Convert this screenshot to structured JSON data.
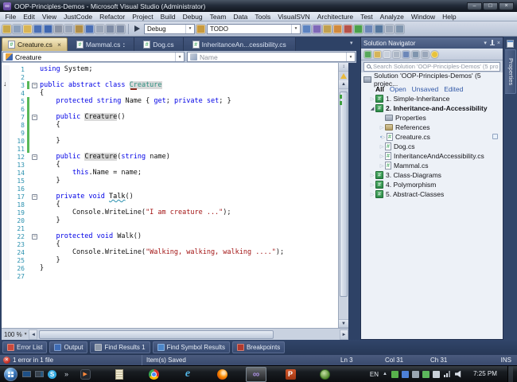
{
  "window": {
    "title": "OOP-Principles-Demos - Microsoft Visual Studio (Administrator)"
  },
  "icons": {
    "close": "×",
    "minimize": "–",
    "maximize": "□",
    "dropdown": "▾",
    "collapsed": "▷",
    "expanded": "◢",
    "fold_collapse": "−",
    "down_arrow": "↓",
    "splitter": "↕",
    "chevron_overflow": "»",
    "scroll_up": "▲",
    "scroll_down": "▼",
    "scroll_left": "◄",
    "scroll_right": "►",
    "infinity": "∞",
    "play": "▶",
    "hash": "#",
    "smiley": "☺"
  },
  "menu": {
    "items": [
      "File",
      "Edit",
      "View",
      "JustCode",
      "Refactor",
      "Project",
      "Build",
      "Debug",
      "Team",
      "Data",
      "Tools",
      "VisualSVN",
      "Architecture",
      "Test",
      "Analyze",
      "Window",
      "Help"
    ]
  },
  "toolbar": {
    "left_icons": [
      {
        "name": "new-project-icon",
        "c": "#C8A84B"
      },
      {
        "name": "add-item-icon",
        "c": "#8CA0BC"
      },
      {
        "name": "open-file-icon",
        "c": "#D9B556"
      },
      {
        "name": "save-icon",
        "c": "#4A6FB5"
      },
      {
        "name": "save-all-icon",
        "c": "#3E66B0"
      },
      {
        "name": "cut-icon",
        "c": "#8A93A5"
      },
      {
        "name": "copy-icon",
        "c": "#9AA5B8"
      },
      {
        "name": "paste-icon",
        "c": "#B08E4A"
      },
      {
        "name": "undo-icon",
        "c": "#4A6FB5"
      },
      {
        "name": "redo-icon",
        "c": "#9AA5B8"
      },
      {
        "name": "navigate-backward-icon",
        "c": "#7E8CA6"
      },
      {
        "name": "navigate-forward-icon",
        "c": "#7E8CA6"
      }
    ],
    "config_combo": {
      "value": "Debug"
    },
    "mid_icon": {
      "name": "todo-comment-icon",
      "c": "#C89A3E"
    },
    "todo_combo": {
      "value": "TODO"
    },
    "right_icons": [
      {
        "name": "solution-explorer-icon",
        "c": "#5B82C0"
      },
      {
        "name": "team-explorer-icon",
        "c": "#7E68B8"
      },
      {
        "name": "server-explorer-icon",
        "c": "#C0A050"
      },
      {
        "name": "toolbox-icon",
        "c": "#D08A3E"
      },
      {
        "name": "extensions-icon",
        "c": "#B5524A"
      },
      {
        "name": "run-tests-icon",
        "c": "#4BA04B"
      },
      {
        "name": "class-view-icon",
        "c": "#6C87B8"
      },
      {
        "name": "bookmark-icon",
        "c": "#55779F"
      },
      {
        "name": "format-icon",
        "c": "#9AA7BA"
      },
      {
        "name": "options-icon",
        "c": "#8095AE"
      }
    ]
  },
  "document_tabs": [
    {
      "label": "Creature.cs",
      "active": true,
      "closable": true
    },
    {
      "label": "Mammal.cs",
      "active": false,
      "modified": true
    },
    {
      "label": "Dog.cs",
      "active": false
    },
    {
      "label": "InheritanceAn...cessibility.cs",
      "active": false
    }
  ],
  "navigation_bar": {
    "type_dropdown": "Creature",
    "member_dropdown": "Name"
  },
  "editor": {
    "zoom_level": "100 %",
    "code_lines": [
      {
        "segs": [
          [
            "kw",
            "using"
          ],
          [
            "pl",
            " System;"
          ]
        ]
      },
      {
        "segs": []
      },
      {
        "fold": 1,
        "chg": 1,
        "segs": [
          [
            "kw",
            "public abstract class"
          ],
          [
            "pl",
            " "
          ],
          [
            "tyh smart",
            "Creature"
          ]
        ]
      },
      {
        "segs": [
          [
            "pl",
            "{"
          ]
        ]
      },
      {
        "chg": 1,
        "segs": [
          [
            "pl",
            "    "
          ],
          [
            "kw",
            "protected"
          ],
          [
            "pl",
            " "
          ],
          [
            "kw",
            "string"
          ],
          [
            "pl",
            " Name { "
          ],
          [
            "kw",
            "get"
          ],
          [
            "pl",
            "; "
          ],
          [
            "kw",
            "private"
          ],
          [
            "pl",
            " "
          ],
          [
            "kw",
            "set"
          ],
          [
            "pl",
            "; }"
          ]
        ]
      },
      {
        "chg": 1,
        "segs": []
      },
      {
        "fold": 1,
        "chg": 1,
        "segs": [
          [
            "pl",
            "    "
          ],
          [
            "kw",
            "public"
          ],
          [
            "pl",
            " "
          ],
          [
            "plh",
            "Creature"
          ],
          [
            "pl",
            "()"
          ]
        ]
      },
      {
        "chg": 1,
        "segs": [
          [
            "pl",
            "    {"
          ]
        ]
      },
      {
        "chg": 1,
        "segs": []
      },
      {
        "chg": 1,
        "segs": [
          [
            "pl",
            "    }"
          ]
        ]
      },
      {
        "chg": 1,
        "segs": []
      },
      {
        "fold": 1,
        "segs": [
          [
            "pl",
            "    "
          ],
          [
            "kw",
            "public"
          ],
          [
            "pl",
            " "
          ],
          [
            "plh",
            "Creature"
          ],
          [
            "pl",
            "("
          ],
          [
            "kw",
            "string"
          ],
          [
            "pl",
            " name)"
          ]
        ]
      },
      {
        "segs": [
          [
            "pl",
            "    {"
          ]
        ]
      },
      {
        "segs": [
          [
            "pl",
            "        "
          ],
          [
            "kw",
            "this"
          ],
          [
            "pl",
            ".Name = name;"
          ]
        ]
      },
      {
        "segs": [
          [
            "pl",
            "    }"
          ]
        ]
      },
      {
        "segs": []
      },
      {
        "fold": 1,
        "segs": [
          [
            "pl",
            "    "
          ],
          [
            "kw",
            "private"
          ],
          [
            "pl",
            " "
          ],
          [
            "kw",
            "void"
          ],
          [
            "pl",
            " "
          ],
          [
            "sq",
            "Talk"
          ],
          [
            "pl",
            "()"
          ]
        ]
      },
      {
        "segs": [
          [
            "pl",
            "    {"
          ]
        ]
      },
      {
        "segs": [
          [
            "pl",
            "        Console.WriteLine("
          ],
          [
            "str",
            "\"I am creature ...\""
          ],
          [
            "pl",
            ");"
          ]
        ]
      },
      {
        "segs": [
          [
            "pl",
            "    }"
          ]
        ]
      },
      {
        "segs": []
      },
      {
        "fold": 1,
        "segs": [
          [
            "pl",
            "    "
          ],
          [
            "kw",
            "protected"
          ],
          [
            "pl",
            " "
          ],
          [
            "kw",
            "void"
          ],
          [
            "pl",
            " Walk()"
          ]
        ]
      },
      {
        "segs": [
          [
            "pl",
            "    {"
          ]
        ]
      },
      {
        "segs": [
          [
            "pl",
            "        Console.WriteLine("
          ],
          [
            "str",
            "\"Walking, walking, walking ....\""
          ],
          [
            "pl",
            ");"
          ]
        ]
      },
      {
        "segs": [
          [
            "pl",
            "    }"
          ]
        ]
      },
      {
        "segs": [
          [
            "pl",
            "}"
          ]
        ]
      },
      {
        "segs": []
      }
    ]
  },
  "solution_navigator": {
    "title": "Solution Navigator",
    "search_placeholder": "Search Solution 'OOP-Principles-Demos' (5 pro",
    "root_label": "Solution 'OOP-Principles-Demos' (5 projec...",
    "filters": [
      {
        "label": "All",
        "active": true
      },
      {
        "label": "Open",
        "active": false
      },
      {
        "label": "Unsaved",
        "active": false
      },
      {
        "label": "Edited",
        "active": false
      }
    ],
    "toolbar_icons": [
      {
        "name": "sync-with-active-document-icon",
        "c": "#57A85C"
      },
      {
        "name": "new-folder-icon",
        "c": "#D4B45A"
      },
      {
        "name": "collapse-all-icon",
        "c": "#C8D0DC"
      },
      {
        "name": "copy-icon",
        "c": "#AEB8C6"
      },
      {
        "name": "preview-icon",
        "c": "#6C87B8"
      },
      {
        "name": "view-code-icon",
        "c": "#8095AE"
      },
      {
        "name": "search-settings-icon",
        "c": "#9AA7BA"
      },
      {
        "name": "feedback-smiley-icon",
        "c": "#E8C33C"
      }
    ],
    "items": [
      {
        "label": "1. Simple-Inheritance",
        "kind": "project",
        "collapsed": true
      },
      {
        "label": "2. Inheritance-and-Accessibility",
        "kind": "project",
        "bold": true,
        "expanded": true
      },
      {
        "label": "Properties",
        "kind": "gray",
        "child": true
      },
      {
        "label": "References",
        "kind": "fold",
        "child": true,
        "collapsed": true
      },
      {
        "label": "Creature.cs",
        "kind": "csfile",
        "child": true,
        "collapsed": true,
        "selected": true
      },
      {
        "label": "Dog.cs",
        "kind": "csfile",
        "child": true,
        "collapsed": true
      },
      {
        "label": "InheritanceAndAccessibility.cs",
        "kind": "csfile",
        "child": true,
        "collapsed": true
      },
      {
        "label": "Mammal.cs",
        "kind": "csfile",
        "child": true,
        "collapsed": true
      },
      {
        "label": "3. Class-Diagrams",
        "kind": "project",
        "collapsed": true
      },
      {
        "label": "4. Polymorphism",
        "kind": "project",
        "collapsed": true
      },
      {
        "label": "5. Abstract-Classes",
        "kind": "project",
        "collapsed": true
      }
    ]
  },
  "properties_tab": {
    "label": "Properties"
  },
  "bottom_panel": {
    "tabs": [
      {
        "label": "Error List",
        "c": "#C94A3C"
      },
      {
        "label": "Output",
        "c": "#3E6CB5"
      },
      {
        "label": "Find Results 1",
        "c": "#8C97A8"
      },
      {
        "label": "Find Symbol Results",
        "c": "#4C86C8"
      },
      {
        "label": "Breakpoints",
        "c": "#B03A2E"
      }
    ]
  },
  "status_bar": {
    "error_text": "1 error in 1 file",
    "message": "Item(s) Saved",
    "line": "Ln 3",
    "column": "Col 31",
    "character": "Ch 31",
    "mode": "INS"
  },
  "taskbar": {
    "language": "EN",
    "time": "7:25 PM",
    "apps": [
      {
        "name": "media-player",
        "active": false
      },
      {
        "name": "notepad",
        "active": false
      },
      {
        "name": "chrome",
        "active": false
      },
      {
        "name": "internet-explorer",
        "active": false
      },
      {
        "name": "firefox",
        "active": false
      },
      {
        "name": "visual-studio",
        "active": true
      },
      {
        "name": "powerpoint",
        "active": false
      },
      {
        "name": "camtasia",
        "active": false
      }
    ],
    "tray_chips": [
      {
        "name": "tray-app-green-icon",
        "c": "#58B14C"
      },
      {
        "name": "tray-app-blue-icon",
        "c": "#4C80D8"
      },
      {
        "name": "tray-display-icon",
        "c": "#9AA6B2"
      },
      {
        "name": "tray-shield-icon",
        "c": "#5CB85C"
      },
      {
        "name": "tray-clipboard-icon",
        "c": "#C9D0D9"
      }
    ]
  }
}
